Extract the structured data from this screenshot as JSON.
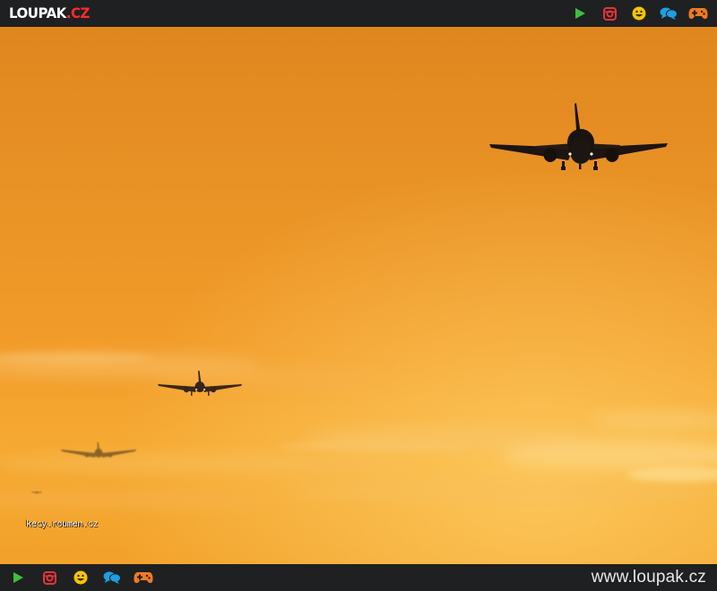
{
  "header": {
    "logo_main": "LOUPAK",
    "logo_tld": ".CZ",
    "icons": [
      "play-icon",
      "instagram-icon",
      "smiley-icon",
      "chat-icon",
      "gamepad-icon"
    ]
  },
  "photo": {
    "watermark": "kecy.roumen.cz"
  },
  "footer": {
    "icons": [
      "play-icon",
      "instagram-icon",
      "smiley-icon",
      "chat-icon",
      "gamepad-icon"
    ],
    "site_url": "www.loupak.cz"
  },
  "colors": {
    "bar_background": "#1f2021",
    "play": "#3fbf3f",
    "instagram": "#e8333a",
    "smiley": "#f5c400",
    "chat": "#1e9fe0",
    "gamepad": "#f07a1f",
    "logo_tld": "#ff2b2b"
  }
}
